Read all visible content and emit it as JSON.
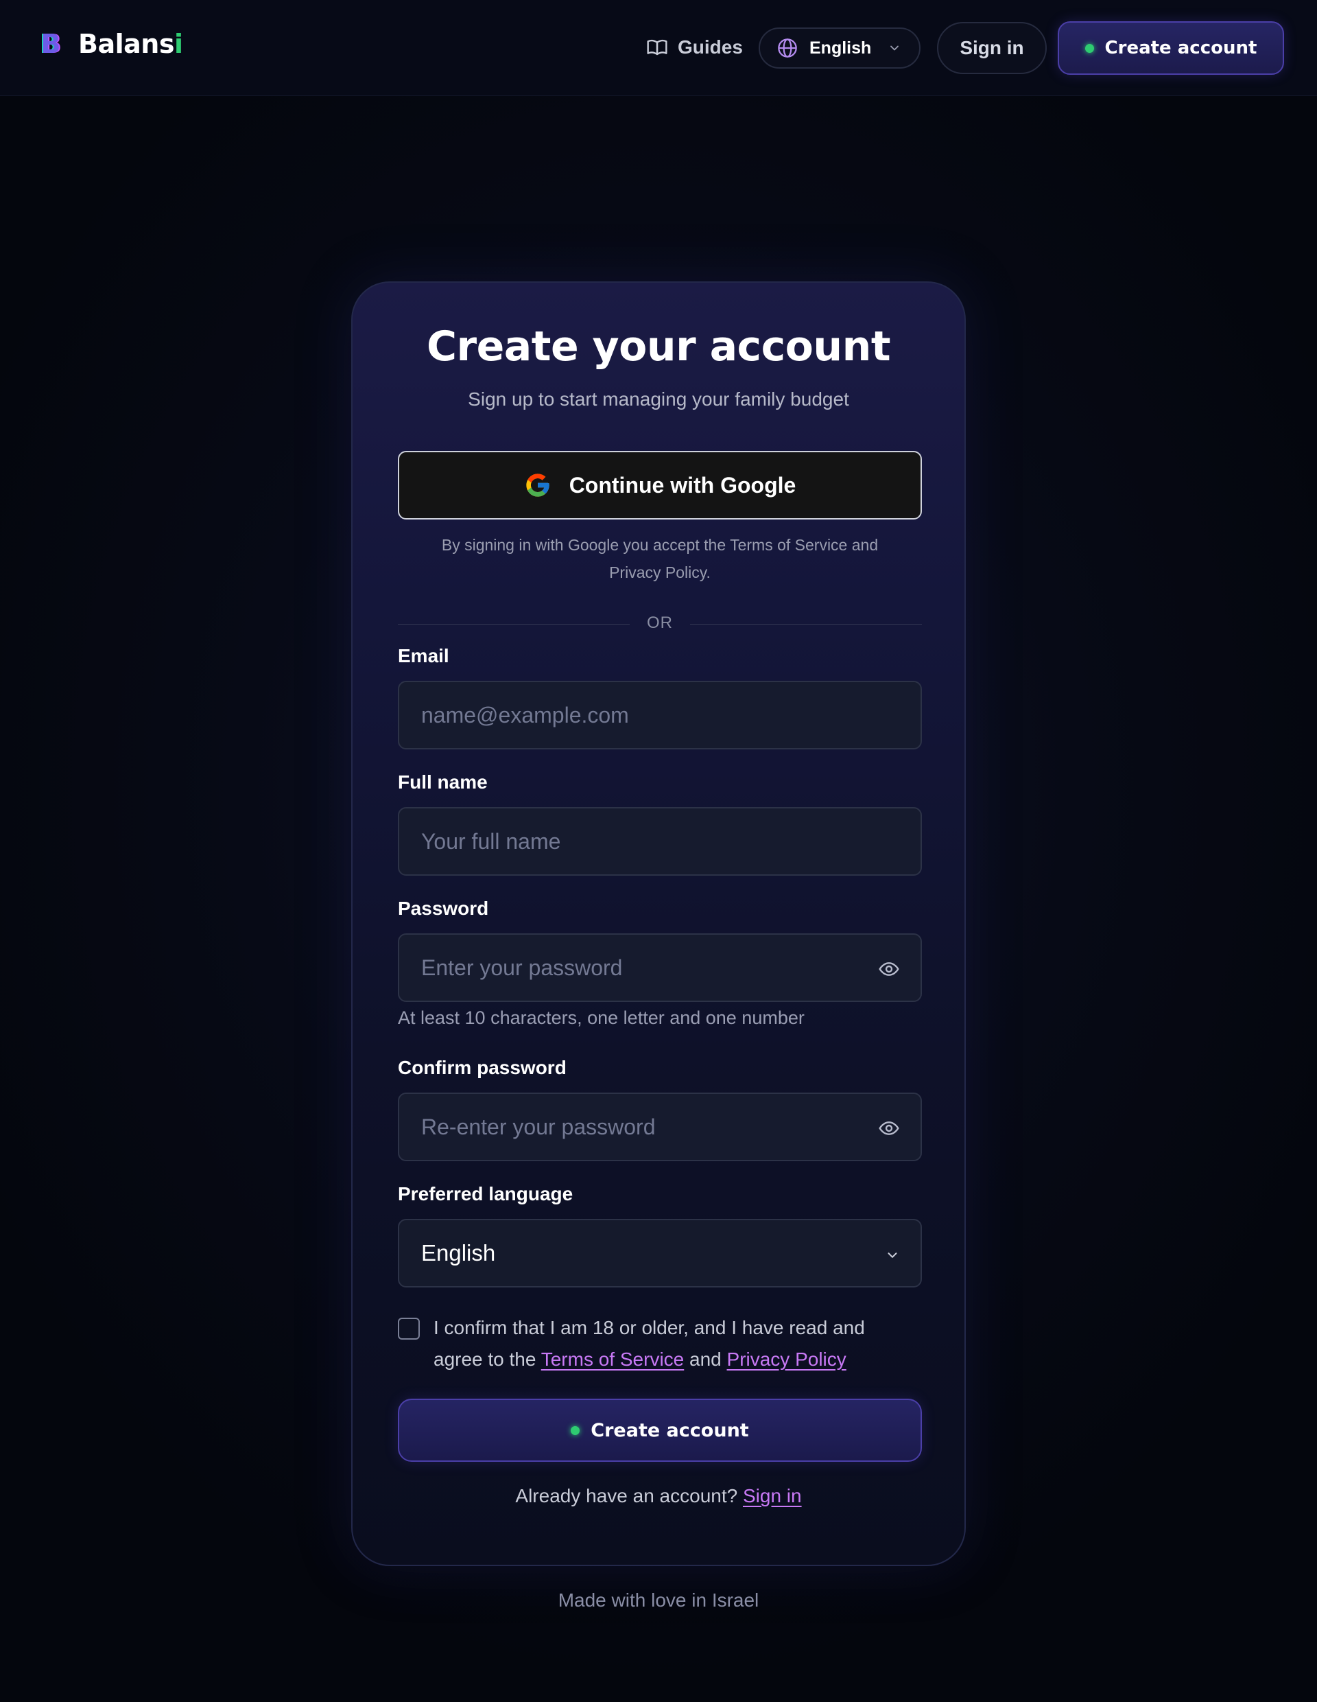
{
  "header": {
    "brand_logo_letter": "B",
    "brand_name_main": "Balans",
    "brand_name_accent": "i",
    "guides_label": "Guides",
    "language_label": "English",
    "signin_label": "Sign in",
    "create_label": "Create account"
  },
  "card": {
    "title": "Create your account",
    "subtitle": "Sign up to start managing your family budget",
    "google_button": "Continue with Google",
    "google_note": "By signing in with Google you accept the Terms of Service and Privacy Policy.",
    "divider": "OR",
    "email": {
      "label": "Email",
      "placeholder": "name@example.com"
    },
    "full_name": {
      "label": "Full name",
      "placeholder": "Your full name"
    },
    "password": {
      "label": "Password",
      "placeholder": "Enter your password",
      "hint": "At least 10 characters, one letter and one number"
    },
    "confirm_password": {
      "label": "Confirm password",
      "placeholder": "Re-enter your password"
    },
    "language": {
      "label": "Preferred language",
      "value": "English"
    },
    "consent": {
      "text_1": "I confirm that I am 18 or older, and I have read and agree to the ",
      "terms_link": "Terms of Service",
      "text_2": " and ",
      "privacy_link": "Privacy Policy",
      "checked": false
    },
    "submit_label": "Create account",
    "already_text": "Already have an account? ",
    "signin_link": "Sign in"
  },
  "footer": "Made with love in Israel",
  "colors": {
    "background": "#05070f",
    "accent_green": "#2ecc71",
    "accent_purple": "#c879f5",
    "button_indigo": "#252463"
  },
  "icons": [
    "book-icon",
    "globe-icon",
    "chevron-down-icon",
    "google-icon",
    "eye-icon",
    "status-dot-icon"
  ]
}
